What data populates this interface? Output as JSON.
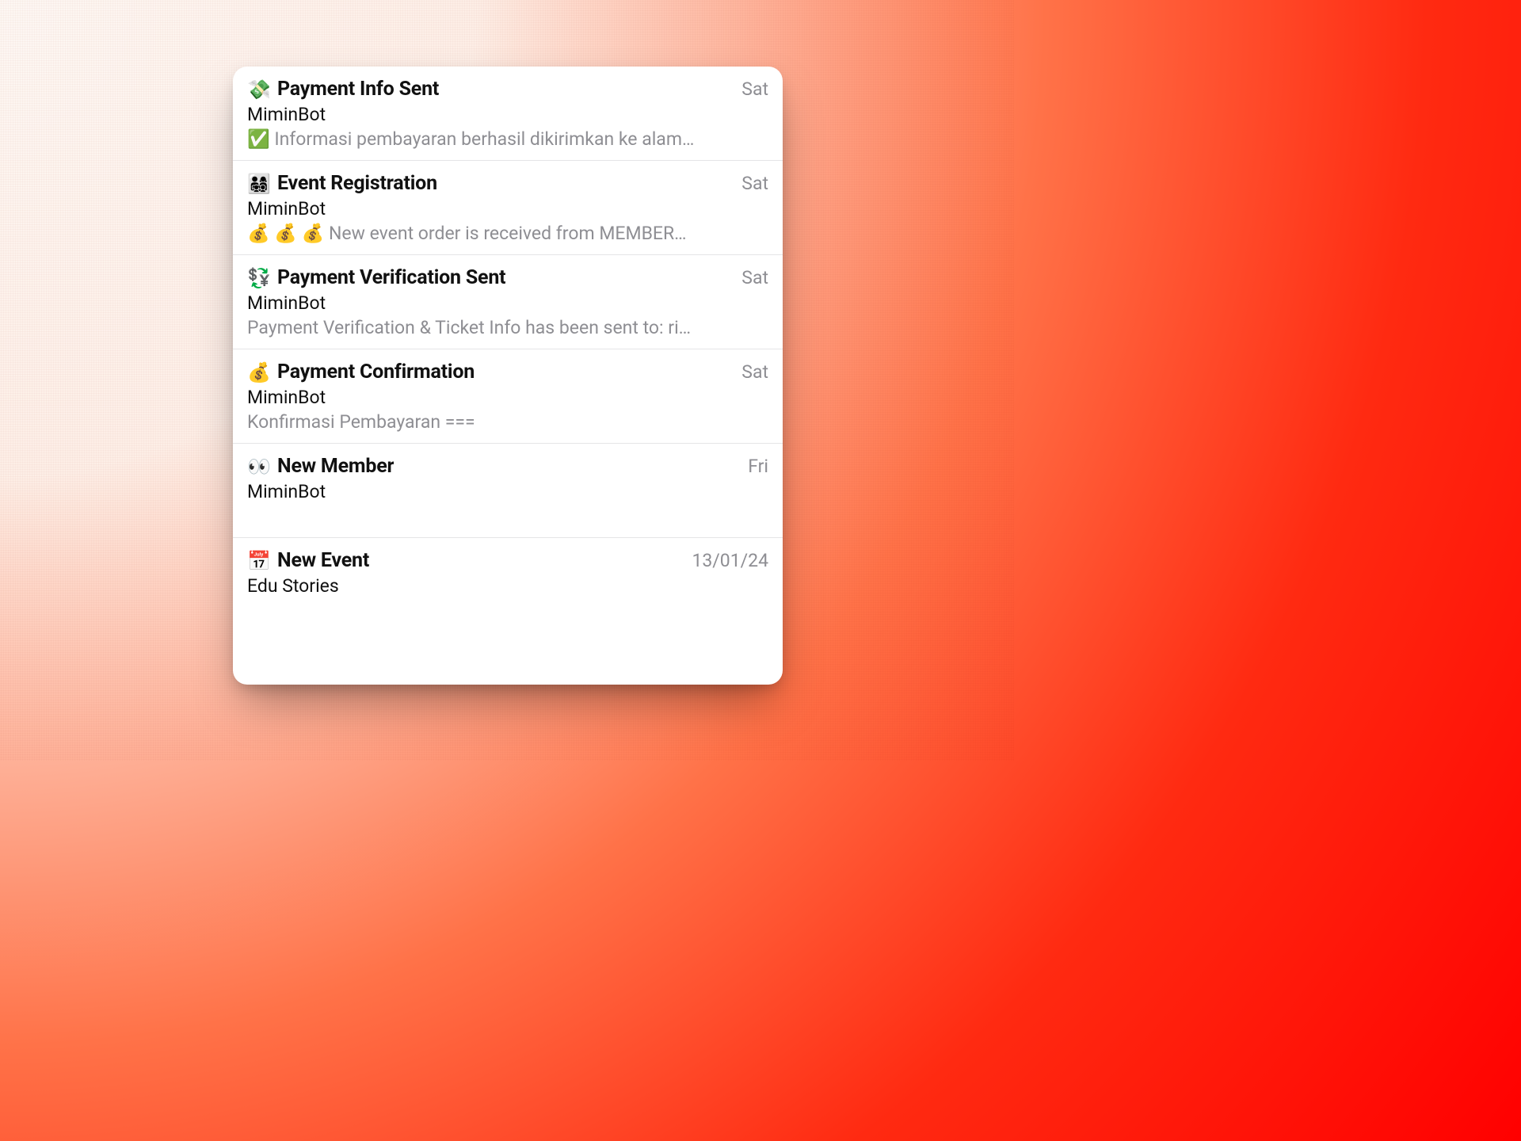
{
  "items": [
    {
      "icon": "💸",
      "title": "Payment Info Sent",
      "timestamp": "Sat",
      "sender": "MiminBot",
      "preview": "✅ Informasi pembayaran berhasil dikirimkan ke alam…"
    },
    {
      "icon": "👨‍👩‍👧‍👦",
      "title": "Event Registration",
      "timestamp": "Sat",
      "sender": "MiminBot",
      "preview": "💰 💰 💰   New event order is received from MEMBER…"
    },
    {
      "icon": "💱",
      "title": "Payment Verification Sent",
      "timestamp": "Sat",
      "sender": "MiminBot",
      "preview": "Payment Verification & Ticket Info has been sent to: ri…"
    },
    {
      "icon": "💰",
      "title": "Payment Confirmation",
      "timestamp": "Sat",
      "sender": "MiminBot",
      "preview": "Konfirmasi Pembayaran ==="
    },
    {
      "icon": "👀",
      "title": "New Member",
      "timestamp": "Fri",
      "sender": "MiminBot",
      "preview": " "
    },
    {
      "icon": "📅",
      "title": "New Event",
      "timestamp": "13/01/24",
      "sender": "Edu Stories",
      "preview": ""
    }
  ]
}
